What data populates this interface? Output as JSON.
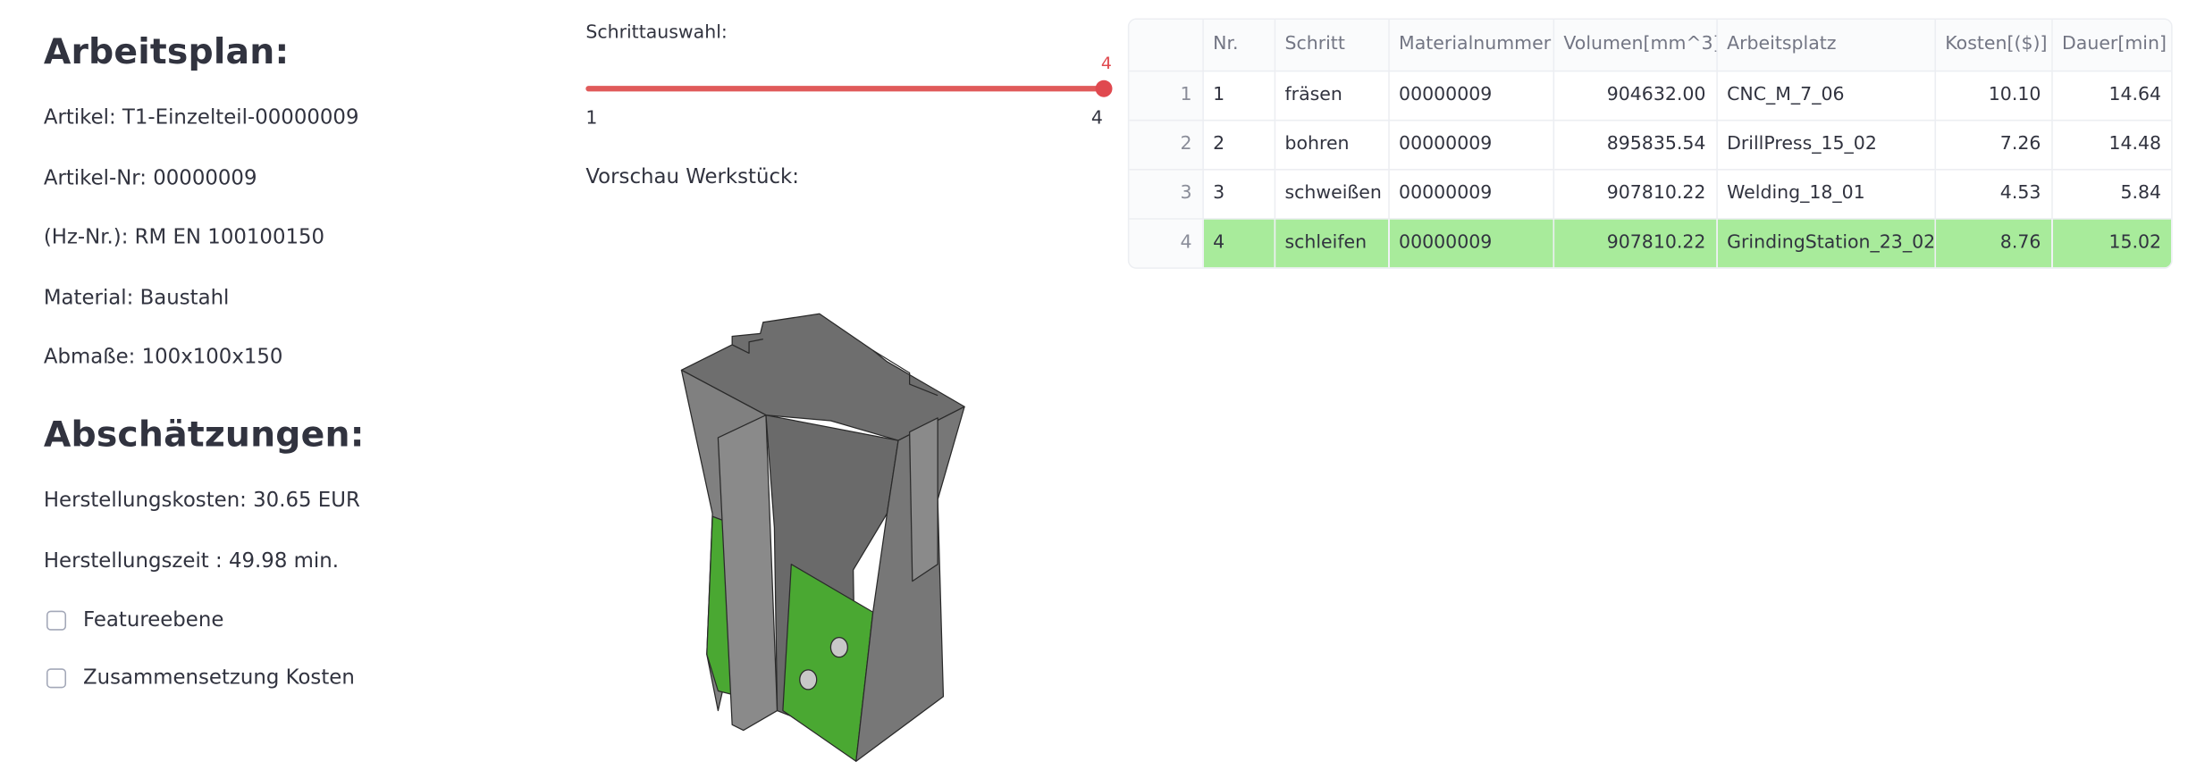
{
  "left": {
    "heading_plan": "Arbeitsplan:",
    "artikel": "Artikel: T1-Einzelteil-00000009",
    "artikel_nr": "Artikel-Nr: 00000009",
    "hz_nr": "(Hz-Nr.): RM EN 100100150",
    "material": "Material: Baustahl",
    "abmasse": "Abmaße: 100x100x150",
    "heading_est": "Abschätzungen:",
    "kosten": "Herstellungskosten: 30.65 EUR",
    "zeit": "Herstellungszeit : 49.98 min.",
    "checkbox_features": "Featureebene",
    "checkbox_costs": "Zusammensetzung Kosten",
    "checkbox_features_checked": false,
    "checkbox_costs_checked": false
  },
  "slider": {
    "label": "Schrittauswahl:",
    "value": "4",
    "min": "1",
    "max": "4",
    "fraction": 1.0,
    "color": "#e0494f"
  },
  "preview": {
    "label": "Vorschau Werkstück:",
    "highlight_color": "#4aa832",
    "body_color": "#7a7a7a"
  },
  "table": {
    "columns": [
      "",
      "Nr.",
      "Schritt",
      "Materialnummer",
      "Volumen[mm^3]",
      "Arbeitsplatz",
      "Kosten[($)]",
      "Dauer[min]"
    ],
    "rows": [
      [
        "1",
        "1",
        "fräsen",
        "00000009",
        "904632.00",
        "CNC_M_7_06",
        "10.10",
        "14.64"
      ],
      [
        "2",
        "2",
        "bohren",
        "00000009",
        "895835.54",
        "DrillPress_15_02",
        "7.26",
        "14.48"
      ],
      [
        "3",
        "3",
        "schweißen",
        "00000009",
        "907810.22",
        "Welding_18_01",
        "4.53",
        "5.84"
      ],
      [
        "4",
        "4",
        "schleifen",
        "00000009",
        "907810.22",
        "GrindingStation_23_02",
        "8.76",
        "15.02"
      ]
    ],
    "highlight_row": 3,
    "highlight_color": "#a8eb9b"
  }
}
